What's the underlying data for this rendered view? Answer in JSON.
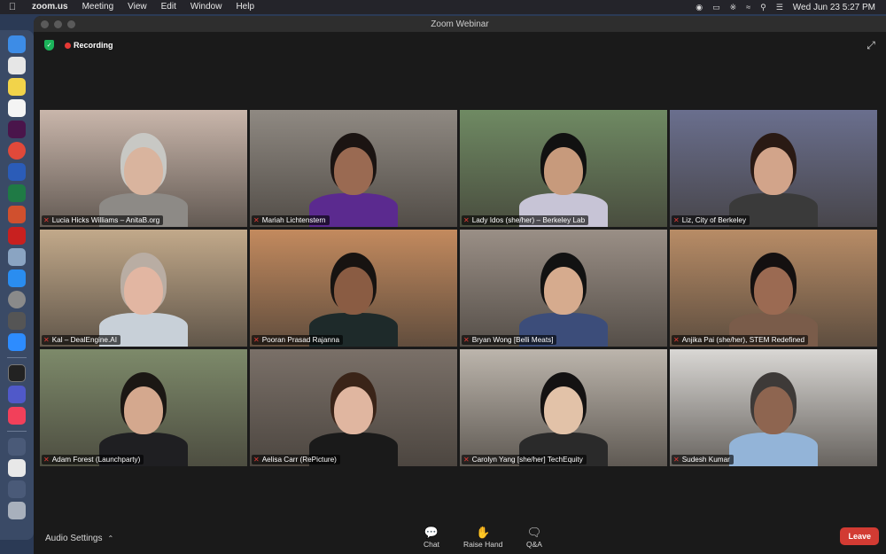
{
  "menubar": {
    "app": "zoom.us",
    "menus": [
      "Meeting",
      "View",
      "Edit",
      "Window",
      "Help"
    ],
    "datetime": "Wed Jun 23  5:27 PM"
  },
  "window": {
    "title": "Zoom Webinar",
    "recording_label": "Recording"
  },
  "participants": [
    {
      "name": "Lucia Hicks Williams – AnitaB.org",
      "bg": "#c9b6ab",
      "skin": "#d9b49e",
      "hair": "#c8c8c4",
      "shirt": "#8d8a86"
    },
    {
      "name": "Mariah Lichtenstern",
      "bg": "#8f8982",
      "skin": "#9a6a52",
      "hair": "#1b1412",
      "shirt": "#5b2a8f"
    },
    {
      "name": "Lady Idos (she/her) – Berkeley Lab",
      "bg": "#6f8a63",
      "skin": "#c79a7c",
      "hair": "#111111",
      "shirt": "#c7c4d6"
    },
    {
      "name": "Liz, City of Berkeley",
      "bg": "#6a6f8e",
      "skin": "#d2a48a",
      "hair": "#2a1a14",
      "shirt": "#3a3a3a"
    },
    {
      "name": "Kal – DealEngine.AI",
      "bg": "#c2a98a",
      "skin": "#e2b6a2",
      "hair": "#b9ada3",
      "shirt": "#c8d0d8"
    },
    {
      "name": "Pooran Prasad Rajanna",
      "bg": "#c38a5e",
      "skin": "#8a5c43",
      "hair": "#171311",
      "shirt": "#1e2a2a"
    },
    {
      "name": "Bryan Wong [Belli Meats]",
      "bg": "#9a8f86",
      "skin": "#d6ab8e",
      "hair": "#121212",
      "shirt": "#3c4d7a"
    },
    {
      "name": "Anjika Pai (she/her), STEM Redefined",
      "bg": "#b88c66",
      "skin": "#9b6a52",
      "hair": "#141010",
      "shirt": "#7a5c4a"
    },
    {
      "name": "Adam Forest (Launchparty)",
      "bg": "#7d8a6a",
      "skin": "#d4a88e",
      "hair": "#1b1714",
      "shirt": "#1f1f22"
    },
    {
      "name": "Aelisa Carr (RePicture)",
      "bg": "#7a7068",
      "skin": "#e0b6a0",
      "hair": "#3a2418",
      "shirt": "#1a1a1a"
    },
    {
      "name": "Carolyn Yang [she/her] TechEquity",
      "bg": "#bcb5ac",
      "skin": "#e2c2a8",
      "hair": "#141212",
      "shirt": "#2a2a2a"
    },
    {
      "name": "Sudesh Kumar",
      "bg": "#d9d7d4",
      "skin": "#8e6550",
      "hair": "#3e3a38",
      "shirt": "#93b4d8"
    }
  ],
  "toolbar": {
    "audio_settings": "Audio Settings",
    "chat": "Chat",
    "raise_hand": "Raise Hand",
    "qa": "Q&A",
    "leave": "Leave"
  },
  "colors": {
    "active_speaker_border": "#d6e24a",
    "leave_button": "#d23b33",
    "recording_dot": "#e53935",
    "mic_muted": "#e53935"
  }
}
